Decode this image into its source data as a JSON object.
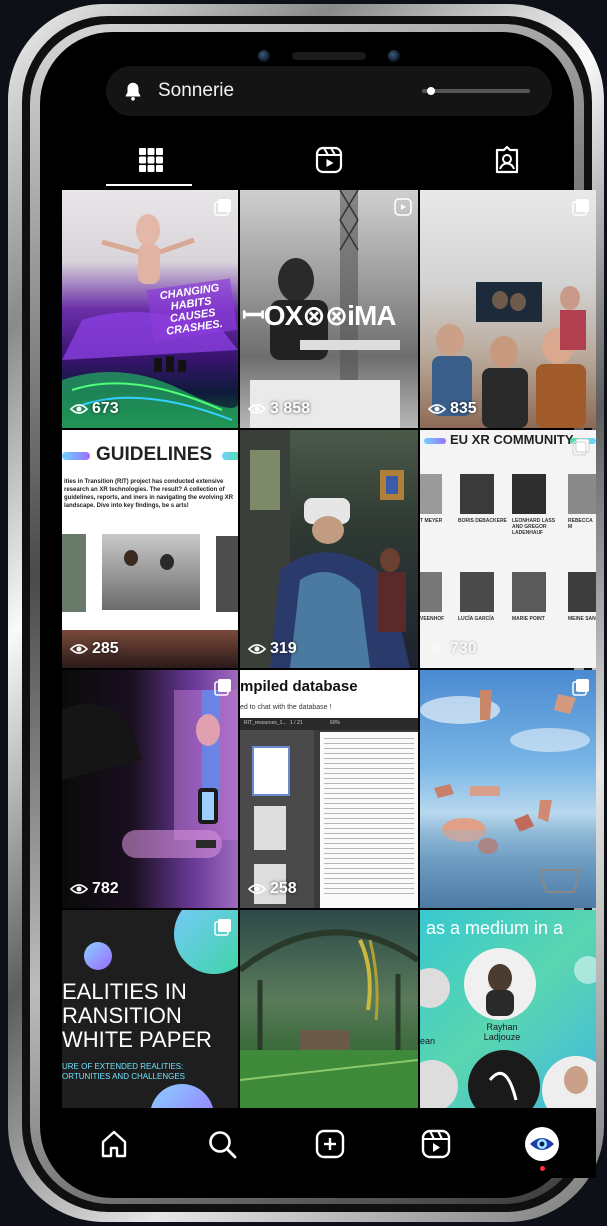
{
  "notification": {
    "label": "Sonnerie",
    "volume_fraction": 0.05
  },
  "tabs": [
    {
      "icon": "grid-icon",
      "active": true
    },
    {
      "icon": "reels-icon",
      "active": false
    },
    {
      "icon": "tagged-icon",
      "active": false
    }
  ],
  "posts": [
    {
      "views": "673",
      "overlay": "CHANGING HABITS CAUSES CRASHES.",
      "multi": true
    },
    {
      "views": "3 858",
      "overlay": "ꟷOX⊗⊗iMA",
      "reel": true
    },
    {
      "views": "835",
      "multi": true
    },
    {
      "views": "285",
      "heading": "GUIDELINES",
      "body": "ities in Transition (RIT) project has conducted extensive research an XR technologies. The result? A collection of guidelines, reports, and iners in navigating the evolving XR landscape. Dive into key findings, be s arts!"
    },
    {
      "views": "319"
    },
    {
      "views": "730",
      "heading": "EU XR COMMUNITY",
      "names": [
        "T MEYER",
        "BORIS DEBACKERE",
        "LEONHARD LASS AND GREGOR LADENHAUF",
        "REBECCA M",
        "VEENHOF",
        "LUCÍA GARCÍA",
        "MARIE POINT",
        "MEINE SAN"
      ]
    },
    {
      "views": "782",
      "multi": true
    },
    {
      "views": "258",
      "heading": "mpiled database",
      "sub": "ed to chat with the database !",
      "toolbar": "RIT_resources_1...",
      "page": "1 / 21",
      "zoom": "60%"
    },
    {
      "multi": true
    },
    {
      "heading": "EALITIES IN RANSITION WHITE PAPER",
      "sub": "URE OF EXTENDED REALITIES: ORTUNITIES AND CHALLENGES",
      "multi": true
    },
    {},
    {
      "heading": "as a medium in a",
      "person": "Rayhan Ladjouze",
      "side_name": "ean"
    }
  ],
  "colors": {
    "accent_red": "#ff3040",
    "bg": "#000000",
    "text": "#ffffff"
  },
  "bottom_nav": [
    {
      "icon": "home-icon"
    },
    {
      "icon": "search-icon"
    },
    {
      "icon": "add-post-icon"
    },
    {
      "icon": "reels-icon"
    },
    {
      "icon": "profile-avatar-icon"
    }
  ]
}
